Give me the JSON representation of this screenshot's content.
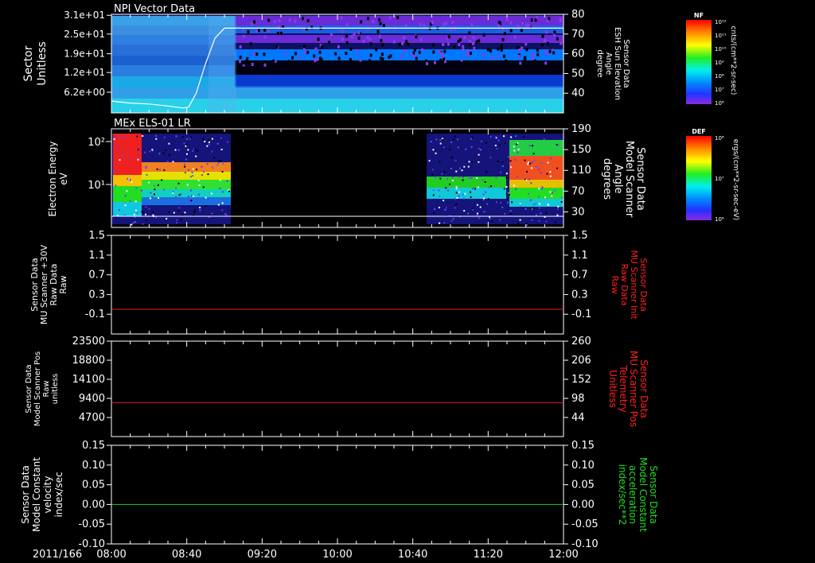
{
  "time_axis": {
    "date_label": "2011/166",
    "ticks": [
      "08:00",
      "08:40",
      "09:20",
      "10:00",
      "10:40",
      "11:20",
      "12:00"
    ]
  },
  "chart_data": [
    {
      "type": "heatmap",
      "title": "NPI Vector Data",
      "ylabel_left": [
        "Sector",
        "Unitless"
      ],
      "yticks_left": [
        "3.1e+01",
        "2.5e+01",
        "1.9e+01",
        "1.2e+01",
        "6.2e+00"
      ],
      "ylabel_right": [
        "Sensor Data",
        "ESH Sun Elevation",
        "Angle",
        "degree"
      ],
      "yticks_right": [
        "80",
        "70",
        "60",
        "50",
        "40"
      ],
      "ylim_right": [
        30,
        80
      ],
      "overlay_line": {
        "name": "ESH Sun Elevation Angle",
        "color": "#ffffff",
        "x": [
          "08:00",
          "08:10",
          "08:20",
          "08:30",
          "08:38",
          "08:41",
          "08:45",
          "08:50",
          "08:55",
          "09:00",
          "10:00",
          "11:00",
          "12:00"
        ],
        "y": [
          36,
          35,
          34.5,
          33.5,
          32.5,
          33,
          40,
          55,
          68,
          73,
          73,
          73,
          73
        ]
      },
      "colorbar": {
        "label": "NF",
        "unit": "cnts/(cm**2-sr-sec)",
        "ticks": [
          "10¹²",
          "10¹¹",
          "10¹⁰",
          "10⁹",
          "10⁸",
          "10⁷",
          "10⁶"
        ]
      }
    },
    {
      "type": "heatmap",
      "title": "MEx ELS-01 LR",
      "ylabel_left": [
        "Electron Energy",
        "eV"
      ],
      "yticks_left": [
        "10²",
        "10¹"
      ],
      "ylabel_right": [
        "Sensor Data",
        "Model Scanner",
        "Angle",
        "degrees"
      ],
      "yticks_right": [
        "190",
        "150",
        "110",
        "70",
        "30"
      ],
      "ylim_right": [
        0,
        190
      ],
      "data_gaps": [
        [
          "09:03",
          "10:50"
        ]
      ],
      "colorbar": {
        "label": "DEF",
        "unit": "ergs/(cm**2-sr-sec-eV)",
        "ticks": [
          "10⁸",
          "10⁷",
          "10⁶"
        ]
      }
    },
    {
      "type": "line",
      "ylabel_left": [
        "Sensor Data",
        "MU Scanner +30V",
        "Raw Data",
        "Raw"
      ],
      "yticks_left": [
        "1.5",
        "1.1",
        "0.7",
        "0.3",
        "-0.1"
      ],
      "ylim": [
        -0.5,
        1.5
      ],
      "ylabel_right": [
        "Sensor Data",
        "MU Scanner Init",
        "Raw Data",
        "Raw"
      ],
      "yticks_right": [
        "1.5",
        "1.1",
        "0.7",
        "0.3",
        "-0.1"
      ],
      "series": [
        {
          "color": "#dd2222",
          "value": 0
        }
      ]
    },
    {
      "type": "line",
      "ylabel_left": [
        "Sensor Data",
        "Model Scanner Pos",
        "Raw",
        "unitless"
      ],
      "yticks_left": [
        "23500",
        "18800",
        "14100",
        "9400",
        "4700"
      ],
      "ylim": [
        0,
        23500
      ],
      "ylabel_right": [
        "Sensor Data",
        "MU Scanner Pos",
        "Telemetry",
        "Unitless"
      ],
      "yticks_right": [
        "260",
        "206",
        "152",
        "98",
        "44"
      ],
      "series": [
        {
          "color": "#dd2222",
          "value": 8350
        }
      ]
    },
    {
      "type": "line",
      "ylabel_left": [
        "Sensor Data",
        "Model Constant",
        "velocity",
        "index/sec"
      ],
      "yticks_left": [
        "0.15",
        "0.10",
        "0.05",
        "0.00",
        "-0.05",
        "-0.10"
      ],
      "ylim": [
        -0.1,
        0.15
      ],
      "ylabel_right": [
        "Sensor Data",
        "Model Constant",
        "acceleration",
        "index/sec**2"
      ],
      "yticks_right": [
        "0.15",
        "0.10",
        "0.05",
        "0.00",
        "-0.05",
        "-0.10"
      ],
      "series": [
        {
          "color": "#22cc22",
          "value": 0
        }
      ]
    }
  ],
  "colors": {
    "right_label_red": "#ff2020",
    "right_label_green": "#22dd22"
  }
}
